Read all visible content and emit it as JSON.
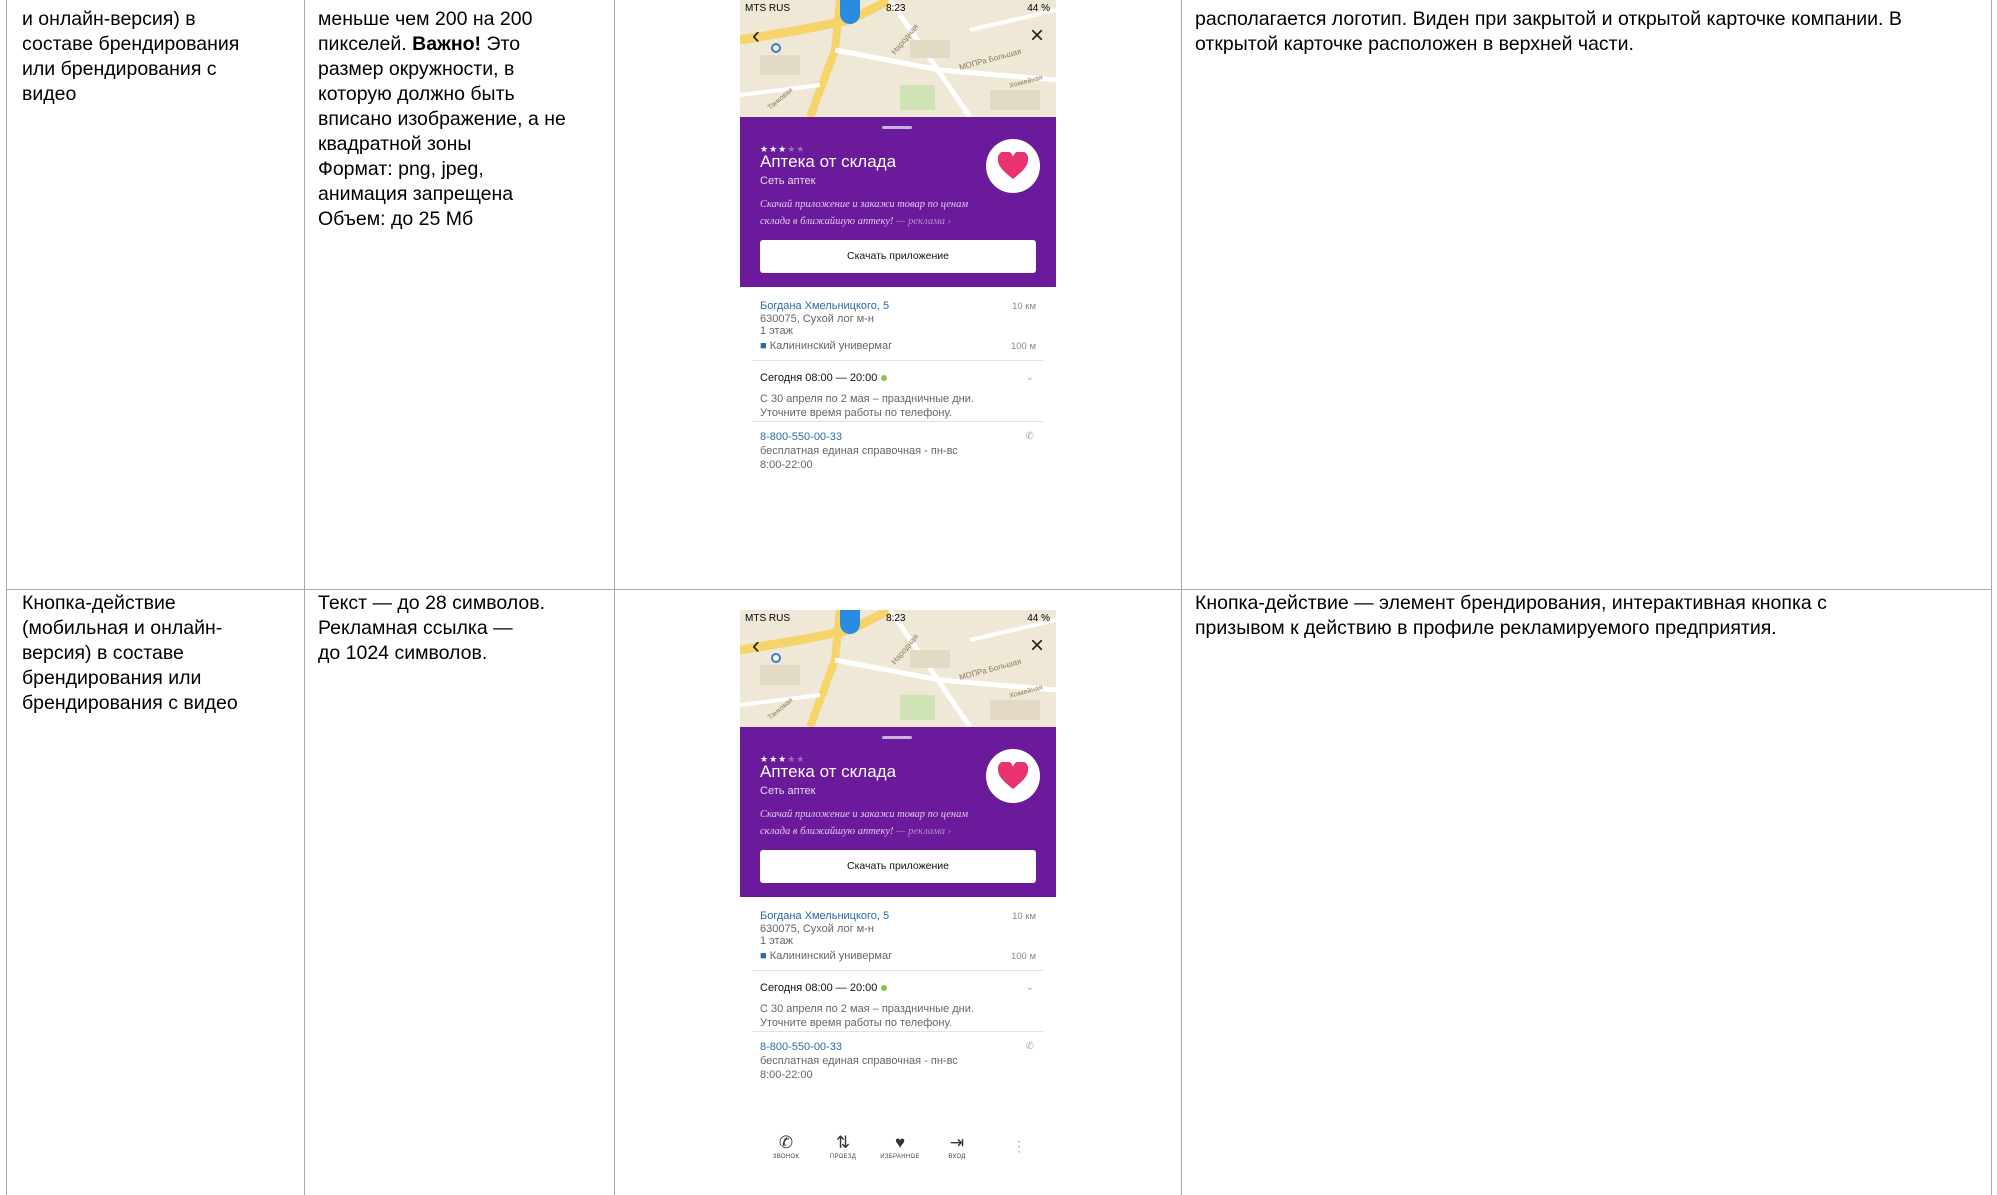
{
  "rows": [
    {
      "col1": "и онлайн-версия) в\nсоставе брендирования\nили брендирования с\nвидео",
      "col2_before_bold": "меньше чем 200 на 200\nпикселей. ",
      "col2_bold": "Важно!",
      "col2_after_bold": " Это\nразмер окружности, в\nкоторую должно быть\nвписано изображение, а не\nквадратной зоны\nФормат: png, jpeg,\nанимация запрещена\nОбъем: до 25 Мб",
      "col4": "располагается логотип. Виден при закрытой и открытой карточке компании. В\nоткрытой карточке расположен в верхней части."
    },
    {
      "col1": "Кнопка-действие\n(мобильная и онлайн-\nверсия) в составе\nбрендирования или\nбрендирования с видео",
      "col2": "Текст — до 28 символов.\nРекламная ссылка —\nдо 1024 символов.",
      "col4": "Кнопка-действие — элемент брендирования, интерактивная кнопка с\nпризывом к действию в профиле рекламируемого предприятия."
    }
  ],
  "phone": {
    "carrier": "MTS RUS",
    "time": "8:23",
    "battery": "44 %",
    "map_labels": [
      "Народная",
      "МОПРа Большая",
      "Хоккейная",
      "Танковая"
    ],
    "stars_on": "★★★",
    "stars_off": "★★",
    "business_name": "Аптека от склада",
    "business_sub": "Сеть аптек",
    "promo_text": "Скачай приложение и закажи товар по ценам склада в ближайшую аптеку!",
    "promo_ad": " — реклама ›",
    "cta_label": "Скачать приложение",
    "address": "Богдана Хмельницкого, 5",
    "address_dist": "10 км",
    "address_line2": "630075, Сухой лог м-н",
    "address_line3": "1 этаж",
    "stop_name": "Калининский универмаг",
    "stop_dist": "100 м",
    "hours": "Сегодня 08:00 — 20:00",
    "hours_note": "С 30 апреля по 2 мая – праздничные дни.\nУточните время работы по телефону.",
    "phone_number": "8-800-550-00-33",
    "phone_note": "бесплатная единая справочная - пн-вс\n8:00-22:00",
    "tabs": [
      {
        "icon": "phone-icon",
        "glyph": "✆",
        "label": "ЗВОНОК"
      },
      {
        "icon": "route-icon",
        "glyph": "⇅",
        "label": "ПРОЕЗД"
      },
      {
        "icon": "heart-icon",
        "glyph": "♥",
        "label": "ИЗБРАННОЕ"
      },
      {
        "icon": "login-icon",
        "glyph": "⇥",
        "label": "ВХОД"
      }
    ],
    "more_glyph": "⋮"
  },
  "colors": {
    "brand_purple": "#6a1a9a",
    "heart_pink": "#e8336f",
    "link_blue": "#2a6aa8",
    "open_green": "#8bc34a"
  }
}
